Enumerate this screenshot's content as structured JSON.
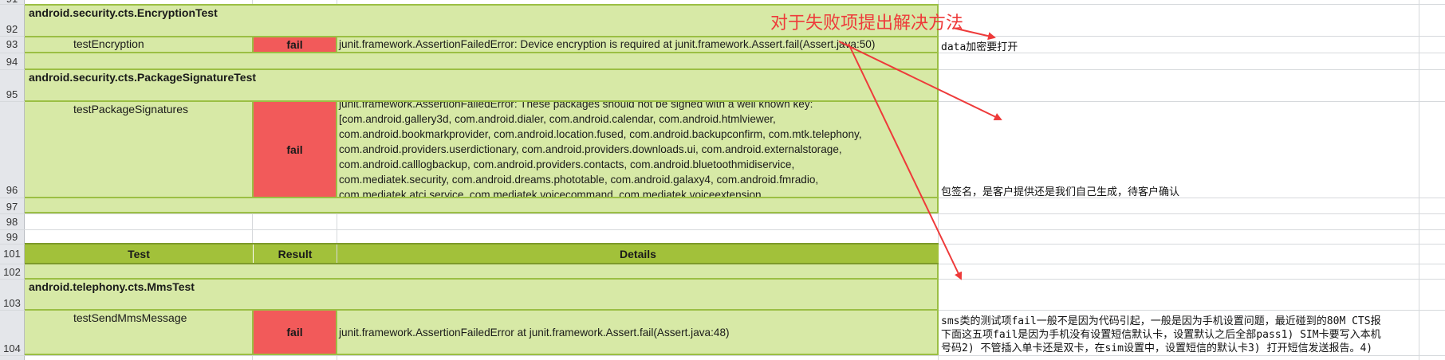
{
  "rows": {
    "r91": "91",
    "r92": "92",
    "r93": "93",
    "r94": "94",
    "r95": "95",
    "r96": "96",
    "r97": "97",
    "r98": "98",
    "r99": "99",
    "r101": "101",
    "r102": "102",
    "r103": "103",
    "r104": "104"
  },
  "suites": {
    "encryption": "android.security.cts.EncryptionTest",
    "package_signature": "android.security.cts.PackageSignatureTest",
    "mms": "android.telephony.cts.MmsTest"
  },
  "tests": {
    "encryption": {
      "name": "testEncryption",
      "result": "fail",
      "details": "junit.framework.AssertionFailedError: Device encryption is required at junit.framework.Assert.fail(Assert.java:50)",
      "note": "data加密要打开"
    },
    "package_signatures": {
      "name": "testPackageSignatures",
      "result": "fail",
      "details_lines": [
        "junit.framework.AssertionFailedError: These packages should not be signed with a well known key:",
        "[com.android.gallery3d, com.android.dialer, com.android.calendar, com.android.htmlviewer,",
        "com.android.bookmarkprovider, com.android.location.fused, com.android.backupconfirm, com.mtk.telephony,",
        "com.android.providers.userdictionary, com.android.providers.downloads.ui, com.android.externalstorage,",
        "com.android.calllogbackup, com.android.providers.contacts, com.android.bluetoothmidiservice,",
        "com.mediatek.security, com.android.dreams.phototable, com.android.galaxy4, com.android.fmradio,",
        "com.mediatek.atci.service, com.mediatek.voicecommand, com.mediatek.voiceextension"
      ],
      "note": "包签名，是客户提供还是我们自己生成，待客户确认"
    },
    "mms": {
      "name": "testSendMmsMessage",
      "result": "fail",
      "details": "junit.framework.AssertionFailedError at junit.framework.Assert.fail(Assert.java:48)",
      "note_lines": [
        "sms类的测试项fail一般不是因为代码引起，一般是因为手机设置问题，最近碰到的80M CTS报",
        "下面这五项fail是因为手机没有设置短信默认卡，设置默认之后全部pass1) SIM卡要写入本机",
        "号码2) 不管插入单卡还是双卡，在sim设置中，设置短信的默认卡3) 打开短信发送报告。4)"
      ]
    }
  },
  "table_header": {
    "test": "Test",
    "result": "Result",
    "details": "Details"
  },
  "callout": {
    "text": "对于失败项提出解决方法",
    "color": "#ee3a3a"
  },
  "colors": {
    "green_fill": "#d7e9a6",
    "green_border": "#9bbf44",
    "fail_fill": "#f25a5a",
    "header_fill": "#a2c13a"
  }
}
